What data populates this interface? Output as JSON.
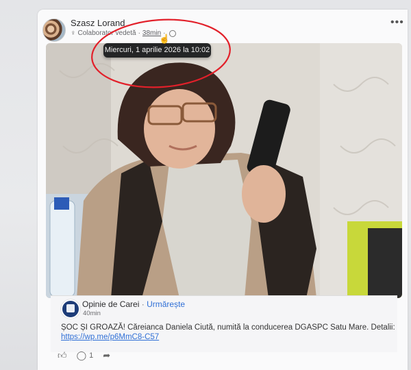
{
  "post": {
    "author": "Szasz Lorand",
    "badge": "Colaborator vedetă",
    "time_short": "38min",
    "tooltip": "Miercuri, 1 aprilie 2026 la 10:02"
  },
  "shared": {
    "page_name": "Opinie de Carei",
    "separator": "·",
    "follow_label": "Urmărește",
    "time": "40min",
    "text": "ȘOC ȘI GROAZĂ! Căreianca Daniela Ciută, numită la conducerea DGASPC Satu Mare. Detalii:",
    "link": "https://wp.me/p6MmC8-C57"
  },
  "actions": {
    "comment_count": "1"
  },
  "colors": {
    "annotation": "#e2202a",
    "link": "#2f6fd6",
    "tooltip_bg": "#242526"
  }
}
